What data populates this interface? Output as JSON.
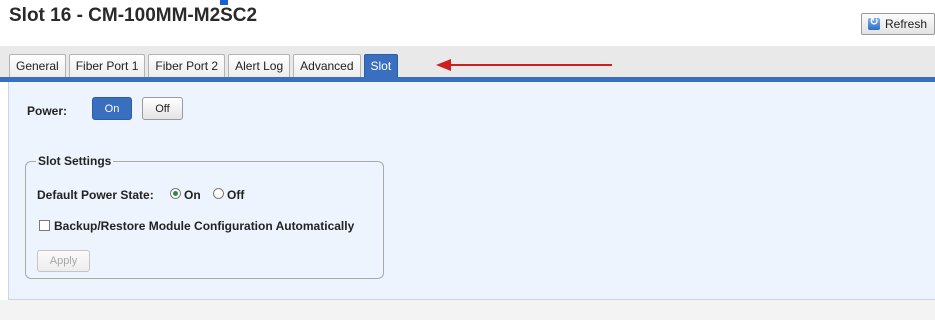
{
  "page": {
    "title": "Slot 16 - CM-100MM-M2SC2",
    "refresh_label": "Refresh"
  },
  "tabs": [
    {
      "label": "General",
      "active": false
    },
    {
      "label": "Fiber Port 1",
      "active": false
    },
    {
      "label": "Fiber Port 2",
      "active": false
    },
    {
      "label": "Alert Log",
      "active": false
    },
    {
      "label": "Advanced",
      "active": false
    },
    {
      "label": "Slot",
      "active": true
    }
  ],
  "power": {
    "label": "Power:",
    "on_label": "On",
    "off_label": "Off",
    "selected": "On"
  },
  "slot_settings": {
    "legend": "Slot Settings",
    "default_power_state_label": "Default Power State:",
    "options": [
      "On",
      "Off"
    ],
    "selected": "On",
    "backup_label": "Backup/Restore Module Configuration Automatically",
    "backup_checked": false,
    "apply_label": "Apply",
    "apply_enabled": false
  },
  "annotation": {
    "arrow_color": "#cc1f1f"
  },
  "colors": {
    "accent": "#3a6fbf",
    "panel_bg": "#eef4fd"
  },
  "icons": {
    "refresh": "refresh-icon"
  }
}
